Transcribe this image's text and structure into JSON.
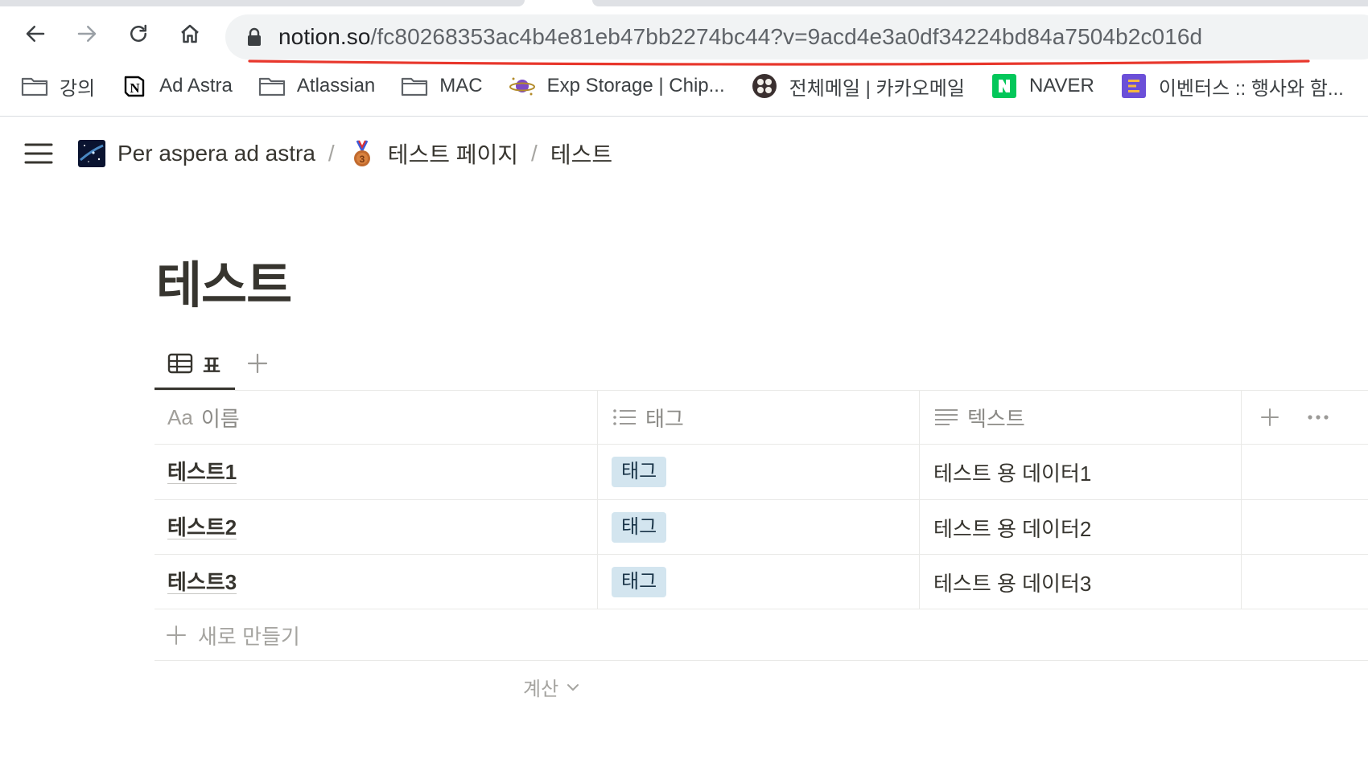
{
  "browser": {
    "url_host": "notion.so",
    "url_path": "/fc80268353ac4b4e81eb47bb2274bc44?v=9acd4e3a0df34224bd84a7504b2c016d",
    "bookmarks": [
      {
        "label": "강의",
        "icon": "folder-icon"
      },
      {
        "label": "Ad Astra",
        "icon": "notion-logo-icon"
      },
      {
        "label": "Atlassian",
        "icon": "folder-icon"
      },
      {
        "label": "MAC",
        "icon": "folder-icon"
      },
      {
        "label": "Exp Storage | Chip...",
        "icon": "planet-icon"
      },
      {
        "label": "전체메일 | 카카오메일",
        "icon": "kakao-icon"
      },
      {
        "label": "NAVER",
        "icon": "naver-icon"
      },
      {
        "label": "이벤터스 :: 행사와 함...",
        "icon": "eventus-icon"
      }
    ],
    "colors": {
      "annotation_red": "#e8372c",
      "naver_green": "#03c75a",
      "eventus_purple": "#6b4fd8"
    }
  },
  "breadcrumb": {
    "items": [
      {
        "label": "Per aspera ad astra",
        "icon": "galaxy-thumbnail-icon"
      },
      {
        "label": "테스트 페이지",
        "icon": "bronze-medal-icon"
      },
      {
        "label": "테스트",
        "icon": ""
      }
    ],
    "separator": "/"
  },
  "page": {
    "title": "테스트",
    "views": [
      {
        "label": "표",
        "icon": "table-icon"
      }
    ],
    "table": {
      "columns": [
        {
          "label": "이름",
          "prefix": "Aa",
          "icon": "title-property-icon"
        },
        {
          "label": "태그",
          "icon": "multi-select-icon"
        },
        {
          "label": "텍스트",
          "icon": "text-property-icon"
        }
      ],
      "rows": [
        {
          "name": "테스트1",
          "tag": "태그",
          "text": "테스트 용 데이터1"
        },
        {
          "name": "테스트2",
          "tag": "태그",
          "text": "테스트 용 데이터2"
        },
        {
          "name": "테스트3",
          "tag": "태그",
          "text": "테스트 용 데이터3"
        }
      ],
      "new_row_label": "새로 만들기",
      "calculate_label": "계산",
      "tag_color": "#d3e5ef"
    }
  }
}
